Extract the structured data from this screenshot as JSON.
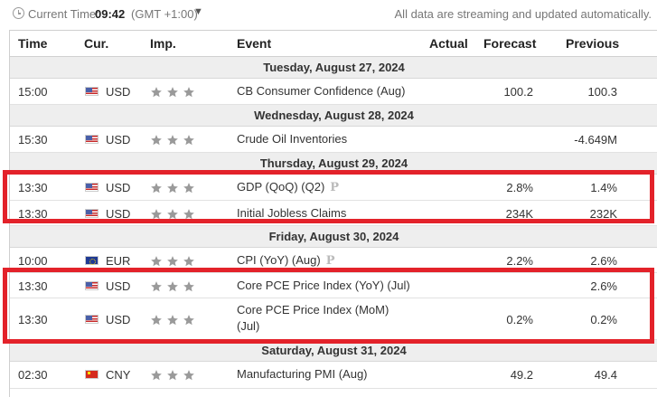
{
  "topbar": {
    "current_time_label": "Current Time:",
    "time": "09:42",
    "zone": "(GMT +1:00)",
    "streaming_note": "All data are streaming and updated automatically."
  },
  "columns": {
    "time": "Time",
    "currency": "Cur.",
    "importance": "Imp.",
    "event": "Event",
    "actual": "Actual",
    "forecast": "Forecast",
    "previous": "Previous"
  },
  "days": [
    {
      "label": "Tuesday, August 27, 2024"
    },
    {
      "label": "Wednesday, August 28, 2024"
    },
    {
      "label": "Thursday, August 29, 2024"
    },
    {
      "label": "Friday, August 30, 2024"
    },
    {
      "label": "Saturday, August 31, 2024"
    }
  ],
  "rows": [
    {
      "time": "15:00",
      "flag": "us-flag",
      "currency": "USD",
      "importance_stars": 3,
      "event": "CB Consumer Confidence (Aug)",
      "preliminary": "",
      "actual": "",
      "forecast": "100.2",
      "previous": "100.3"
    },
    {
      "time": "15:30",
      "flag": "us-flag",
      "currency": "USD",
      "importance_stars": 3,
      "event": "Crude Oil Inventories",
      "preliminary": "",
      "actual": "",
      "forecast": "",
      "previous": "-4.649M"
    },
    {
      "time": "13:30",
      "flag": "us-flag",
      "currency": "USD",
      "importance_stars": 3,
      "event": "GDP (QoQ) (Q2)",
      "preliminary": "P",
      "actual": "",
      "forecast": "2.8%",
      "previous": "1.4%"
    },
    {
      "time": "13:30",
      "flag": "us-flag",
      "currency": "USD",
      "importance_stars": 3,
      "event": "Initial Jobless Claims",
      "preliminary": "",
      "actual": "",
      "forecast": "234K",
      "previous": "232K"
    },
    {
      "time": "10:00",
      "flag": "eu-flag",
      "currency": "EUR",
      "importance_stars": 3,
      "event": "CPI (YoY) (Aug)",
      "preliminary": "P",
      "actual": "",
      "forecast": "2.2%",
      "previous": "2.6%"
    },
    {
      "time": "13:30",
      "flag": "us-flag",
      "currency": "USD",
      "importance_stars": 3,
      "event": "Core PCE Price Index (YoY) (Jul)",
      "preliminary": "",
      "actual": "",
      "forecast": "",
      "previous": "2.6%"
    },
    {
      "time": "13:30",
      "flag": "us-flag",
      "currency": "USD",
      "importance_stars": 3,
      "event_line1": "Core PCE Price Index (MoM)",
      "event_line2": "(Jul)",
      "preliminary": "",
      "actual": "",
      "forecast": "0.2%",
      "previous": "0.2%"
    },
    {
      "time": "02:30",
      "flag": "cn-flag",
      "currency": "CNY",
      "importance_stars": 3,
      "event": "Manufacturing PMI (Aug)",
      "preliminary": "",
      "actual": "",
      "forecast": "49.2",
      "previous": "49.4"
    }
  ],
  "colors": {
    "highlight_box": "#e3222a",
    "day_header_bg": "#eeeeee",
    "star": "#999999"
  },
  "icons": {
    "clock": "clock-icon",
    "chevron": "chevron-down-icon",
    "star": "star-icon",
    "preliminary": "preliminary-p-icon"
  }
}
